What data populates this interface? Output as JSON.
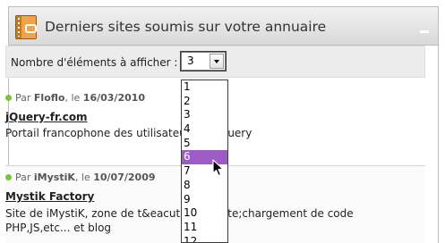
{
  "widget": {
    "title": "Derniers sites soumis sur votre annuaire"
  },
  "toolbar": {
    "count_label": "Nombre d'éléments à afficher :",
    "selected_value": "3"
  },
  "dropdown": {
    "options": [
      "1",
      "2",
      "3",
      "4",
      "5",
      "6",
      "7",
      "8",
      "9",
      "10",
      "11",
      "12"
    ],
    "highlighted": "6"
  },
  "entries": [
    {
      "meta_prefix": "Par",
      "author": "Floflo",
      "date_prefix": ", le",
      "date": "16/03/2010",
      "site_name": "jQuery-fr.com",
      "description": "Portail francophone des utilisateurs de jQuery"
    },
    {
      "meta_prefix": "Par",
      "author": "iMystiK",
      "date_prefix": ", le",
      "date": "10/07/2009",
      "site_name": "Mystik Factory",
      "description": "Site de iMystiK, zone de t&eacute;l&eacute;chargement de code PHP,JS,etc... et blog"
    }
  ],
  "colors": {
    "status_dot": "#7bc23c",
    "selection": "#9d5bc5"
  }
}
